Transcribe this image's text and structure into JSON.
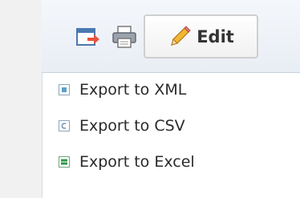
{
  "toolbar": {
    "export_button_icon": "export-arrow-icon",
    "print_button_icon": "printer-icon",
    "edit_button": {
      "icon": "pencil-icon",
      "label": "Edit"
    }
  },
  "export_menu": {
    "items": [
      {
        "label": "Export to XML",
        "icon": "xml-file-icon",
        "icon_color": "#5aa0c8"
      },
      {
        "label": "Export to CSV",
        "icon": "csv-file-icon",
        "icon_color": "#6f8fa8"
      },
      {
        "label": "Export to Excel",
        "icon": "excel-file-icon",
        "icon_color": "#2e9a47"
      }
    ]
  },
  "colors": {
    "toolbar_bg": "#eef2f7",
    "menu_bg": "#ffffff",
    "export_icon_accent": "#e8523a",
    "text": "#2a2a2a"
  }
}
